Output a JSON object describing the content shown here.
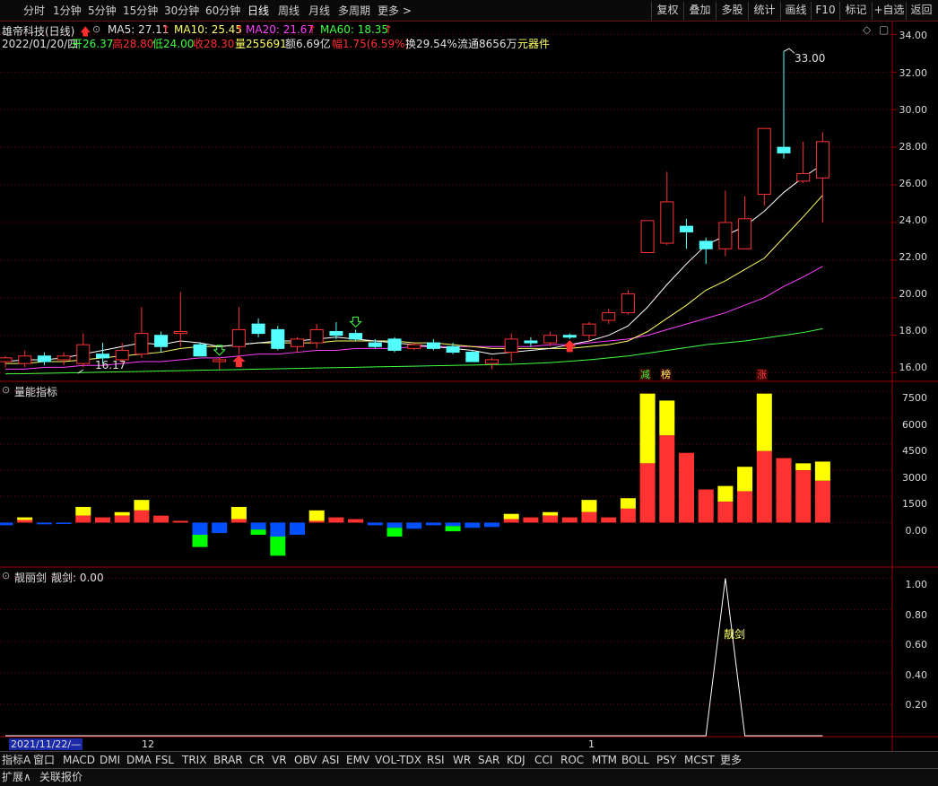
{
  "top_tabs": [
    "分时",
    "1分钟",
    "5分钟",
    "15分钟",
    "30分钟",
    "60分钟",
    "日线",
    "周线",
    "月线",
    "多周期",
    "更多 >"
  ],
  "active_tab": "日线",
  "right_buttons": [
    "复权",
    "叠加",
    "多股",
    "统计",
    "画线",
    "F10",
    "标记",
    "+自选",
    "返回"
  ],
  "stock": {
    "name": "雄帝科技(日线)",
    "ma5_label": "MA5: 27.11",
    "ma10_label": "MA10: 25.45",
    "ma20_label": "MA20: 21.67",
    "ma60_label": "MA60: 18.35",
    "date": "2022/01/20/四",
    "open": "开26.37",
    "high": "高28.80",
    "low": "低24.00",
    "close": "收28.30",
    "volume": "量255691",
    "amount": "额6.69亿",
    "change": "幅1.75(6.59%)",
    "turnover": "换29.54%",
    "float": "流通8656万",
    "sector": "元器件"
  },
  "colors": {
    "up": "#ff3232",
    "down": "#54ffff",
    "ma5": "#ffffff",
    "ma10": "#ffff66",
    "ma20": "#ff40ff",
    "ma60": "#40ff40",
    "grid": "#7a0000",
    "axis": "#a00000",
    "yellow": "#ffff00",
    "green": "#00ff00",
    "blue": "#0050ff"
  },
  "price_axis": [
    "34.00",
    "32.00",
    "30.00",
    "28.00",
    "26.00",
    "24.00",
    "22.00",
    "20.00",
    "18.00",
    "16.00"
  ],
  "max_label": "33.00",
  "min_label": "16.17",
  "candle_tags": [
    "减",
    "榜",
    "涨"
  ],
  "vol_panel": {
    "title": "量能指标",
    "axis": [
      "7500",
      "6000",
      "4500",
      "3000",
      "1500",
      "0.00"
    ]
  },
  "ind_panel": {
    "title": "靓丽剑",
    "value_label": "靓剑: 0.00",
    "annotation": "靓剑",
    "axis": [
      "1.00",
      "0.80",
      "0.60",
      "0.40",
      "0.20"
    ]
  },
  "date_axis": {
    "start": "2021/11/22/—",
    "m12": "12",
    "m1": "1"
  },
  "indicators": [
    "指标A",
    "窗口",
    "MACD",
    "DMI",
    "DMA",
    "FSL",
    "TRIX",
    "BRAR",
    "CR",
    "VR",
    "OBV",
    "ASI",
    "EMV",
    "VOL-TDX",
    "RSI",
    "WR",
    "SAR",
    "KDJ",
    "CCI",
    "ROC",
    "MTM",
    "BOLL",
    "PSY",
    "MCST",
    "更多"
  ],
  "bottom": {
    "expand": "扩展∧",
    "related": "关联报价"
  },
  "chart_data": {
    "type": "candlestick",
    "price_range": [
      15.6,
      34.4
    ],
    "candles": [
      {
        "o": 16.6,
        "h": 16.9,
        "l": 16.3,
        "c": 16.8
      },
      {
        "o": 16.5,
        "h": 17.2,
        "l": 16.3,
        "c": 16.9
      },
      {
        "o": 16.9,
        "h": 17.1,
        "l": 16.4,
        "c": 16.6
      },
      {
        "o": 16.7,
        "h": 17.1,
        "l": 16.4,
        "c": 16.9
      },
      {
        "o": 16.5,
        "h": 18.1,
        "l": 16.3,
        "c": 17.5
      },
      {
        "o": 17.0,
        "h": 17.6,
        "l": 16.5,
        "c": 16.8
      },
      {
        "o": 16.7,
        "h": 17.6,
        "l": 16.5,
        "c": 17.2
      },
      {
        "o": 17.0,
        "h": 19.5,
        "l": 16.8,
        "c": 18.1
      },
      {
        "o": 18.0,
        "h": 18.2,
        "l": 17.1,
        "c": 17.4
      },
      {
        "o": 18.1,
        "h": 20.3,
        "l": 17.4,
        "c": 18.2
      },
      {
        "o": 17.5,
        "h": 17.6,
        "l": 16.9,
        "c": 16.9
      },
      {
        "o": 16.6,
        "h": 16.8,
        "l": 16.2,
        "c": 16.7
      },
      {
        "o": 17.4,
        "h": 19.5,
        "l": 17.0,
        "c": 18.3
      },
      {
        "o": 18.6,
        "h": 18.9,
        "l": 17.9,
        "c": 18.1
      },
      {
        "o": 18.3,
        "h": 18.5,
        "l": 17.2,
        "c": 17.3
      },
      {
        "o": 17.4,
        "h": 17.9,
        "l": 17.1,
        "c": 17.8
      },
      {
        "o": 17.6,
        "h": 18.6,
        "l": 17.3,
        "c": 18.3
      },
      {
        "o": 18.2,
        "h": 18.7,
        "l": 17.8,
        "c": 18.0
      },
      {
        "o": 18.1,
        "h": 18.3,
        "l": 17.7,
        "c": 17.8
      },
      {
        "o": 17.6,
        "h": 17.8,
        "l": 17.3,
        "c": 17.4
      },
      {
        "o": 17.8,
        "h": 17.9,
        "l": 17.1,
        "c": 17.2
      },
      {
        "o": 17.3,
        "h": 17.6,
        "l": 17.2,
        "c": 17.5
      },
      {
        "o": 17.6,
        "h": 17.8,
        "l": 17.2,
        "c": 17.3
      },
      {
        "o": 17.4,
        "h": 17.6,
        "l": 17.0,
        "c": 17.1
      },
      {
        "o": 17.1,
        "h": 17.2,
        "l": 16.6,
        "c": 16.6
      },
      {
        "o": 16.5,
        "h": 16.8,
        "l": 16.2,
        "c": 16.7
      },
      {
        "o": 17.1,
        "h": 18.1,
        "l": 16.6,
        "c": 17.8
      },
      {
        "o": 17.7,
        "h": 17.9,
        "l": 17.4,
        "c": 17.6
      },
      {
        "o": 17.6,
        "h": 18.2,
        "l": 17.4,
        "c": 18.0
      },
      {
        "o": 18.0,
        "h": 18.1,
        "l": 17.8,
        "c": 17.9
      },
      {
        "o": 18.0,
        "h": 18.7,
        "l": 17.7,
        "c": 18.6
      },
      {
        "o": 18.8,
        "h": 19.4,
        "l": 18.6,
        "c": 19.2
      },
      {
        "o": 19.2,
        "h": 20.4,
        "l": 19.1,
        "c": 20.2
      },
      {
        "o": 22.4,
        "h": 22.4,
        "l": 22.4,
        "c": 24.1
      },
      {
        "o": 22.9,
        "h": 26.7,
        "l": 22.8,
        "c": 25.1
      },
      {
        "o": 23.8,
        "h": 24.2,
        "l": 22.6,
        "c": 23.5
      },
      {
        "o": 23.0,
        "h": 23.2,
        "l": 21.8,
        "c": 22.6
      },
      {
        "o": 22.6,
        "h": 25.7,
        "l": 22.2,
        "c": 24.0
      },
      {
        "o": 22.6,
        "h": 25.4,
        "l": 22.6,
        "c": 24.2
      },
      {
        "o": 25.5,
        "h": 29.0,
        "l": 24.9,
        "c": 29.0
      },
      {
        "o": 28.0,
        "h": 33.1,
        "l": 27.4,
        "c": 27.7
      },
      {
        "o": 26.2,
        "h": 28.3,
        "l": 26.1,
        "c": 26.6
      },
      {
        "o": 26.37,
        "h": 28.8,
        "l": 24.0,
        "c": 28.3
      }
    ],
    "ma5": [
      16.6,
      16.7,
      16.7,
      16.8,
      17.0,
      17.2,
      17.4,
      17.6,
      17.5,
      17.7,
      17.6,
      17.4,
      17.5,
      17.6,
      17.7,
      17.7,
      17.8,
      17.9,
      17.8,
      17.7,
      17.6,
      17.5,
      17.4,
      17.3,
      17.2,
      17.0,
      17.1,
      17.2,
      17.3,
      17.5,
      17.7,
      18.0,
      18.5,
      19.5,
      20.7,
      21.8,
      22.8,
      23.3,
      23.8,
      24.6,
      25.6,
      26.4,
      27.1
    ],
    "ma10": [
      16.5,
      16.5,
      16.6,
      16.6,
      16.7,
      16.8,
      16.9,
      17.0,
      17.1,
      17.3,
      17.4,
      17.4,
      17.5,
      17.6,
      17.6,
      17.6,
      17.6,
      17.7,
      17.7,
      17.7,
      17.7,
      17.6,
      17.6,
      17.5,
      17.4,
      17.3,
      17.3,
      17.3,
      17.3,
      17.3,
      17.4,
      17.5,
      17.7,
      18.2,
      18.9,
      19.6,
      20.4,
      20.9,
      21.5,
      22.1,
      23.2,
      24.3,
      25.45
    ],
    "ma20": [
      16.2,
      16.2,
      16.3,
      16.3,
      16.4,
      16.4,
      16.5,
      16.6,
      16.6,
      16.7,
      16.8,
      16.8,
      16.9,
      17.0,
      17.0,
      17.1,
      17.2,
      17.2,
      17.3,
      17.3,
      17.3,
      17.4,
      17.4,
      17.4,
      17.4,
      17.4,
      17.4,
      17.4,
      17.5,
      17.5,
      17.6,
      17.7,
      17.8,
      18.0,
      18.3,
      18.6,
      18.9,
      19.2,
      19.6,
      20.0,
      20.6,
      21.1,
      21.67
    ],
    "ma60": [
      15.95,
      15.96,
      15.98,
      16.0,
      16.02,
      16.04,
      16.06,
      16.08,
      16.1,
      16.12,
      16.14,
      16.16,
      16.18,
      16.2,
      16.22,
      16.24,
      16.26,
      16.28,
      16.3,
      16.32,
      16.34,
      16.36,
      16.38,
      16.4,
      16.42,
      16.44,
      16.46,
      16.5,
      16.55,
      16.62,
      16.7,
      16.8,
      16.9,
      17.05,
      17.2,
      17.35,
      17.5,
      17.6,
      17.7,
      17.85,
      18.0,
      18.15,
      18.35
    ],
    "signal_down_arrows": [
      11,
      18
    ],
    "signal_up_arrows": [
      12,
      29
    ],
    "volume_range": [
      -2500,
      8000
    ],
    "volume": [
      {
        "a": -150,
        "b": 0
      },
      {
        "a": 150,
        "b": 300
      },
      {
        "a": -100,
        "b": 0
      },
      {
        "a": -80,
        "b": 0
      },
      {
        "a": 400,
        "b": 900
      },
      {
        "a": 300,
        "b": 0
      },
      {
        "a": 400,
        "b": 600
      },
      {
        "a": 700,
        "b": 1300
      },
      {
        "a": 400,
        "b": 0
      },
      {
        "a": 100,
        "b": 0
      },
      {
        "a": -700,
        "b": -1400
      },
      {
        "a": -600,
        "b": 0
      },
      {
        "a": 200,
        "b": 900
      },
      {
        "a": -400,
        "b": -700
      },
      {
        "a": -800,
        "b": -1900
      },
      {
        "a": -700,
        "b": 0
      },
      {
        "a": 100,
        "b": 700
      },
      {
        "a": 300,
        "b": 0
      },
      {
        "a": 200,
        "b": 0
      },
      {
        "a": -150,
        "b": 0
      },
      {
        "a": -300,
        "b": -800
      },
      {
        "a": -350,
        "b": 0
      },
      {
        "a": -150,
        "b": 0
      },
      {
        "a": -200,
        "b": -500
      },
      {
        "a": -300,
        "b": 0
      },
      {
        "a": -250,
        "b": 0
      },
      {
        "a": 200,
        "b": 500
      },
      {
        "a": 300,
        "b": 0
      },
      {
        "a": 400,
        "b": 600
      },
      {
        "a": 300,
        "b": 0
      },
      {
        "a": 600,
        "b": 1300
      },
      {
        "a": 300,
        "b": 0
      },
      {
        "a": 800,
        "b": 1400
      },
      {
        "a": 3400,
        "b": 7400
      },
      {
        "a": 5000,
        "b": 7000
      },
      {
        "a": 4000,
        "b": 0
      },
      {
        "a": 1900,
        "b": 0
      },
      {
        "a": 1200,
        "b": 2100
      },
      {
        "a": 1800,
        "b": 3200
      },
      {
        "a": 4100,
        "b": 7400
      },
      {
        "a": 3700,
        "b": 0
      },
      {
        "a": 3000,
        "b": 3400
      },
      {
        "a": 2400,
        "b": 3500
      }
    ],
    "indicator_range": [
      0,
      1.06
    ],
    "indicator": [
      0,
      0,
      0,
      0,
      0,
      0,
      0,
      0,
      0,
      0,
      0,
      0,
      0,
      0,
      0,
      0,
      0,
      0,
      0,
      0,
      0,
      0,
      0,
      0,
      0,
      0,
      0,
      0,
      0,
      0,
      0,
      0,
      0,
      0,
      0,
      0,
      0,
      1.0,
      0,
      0,
      0,
      0,
      0
    ]
  }
}
